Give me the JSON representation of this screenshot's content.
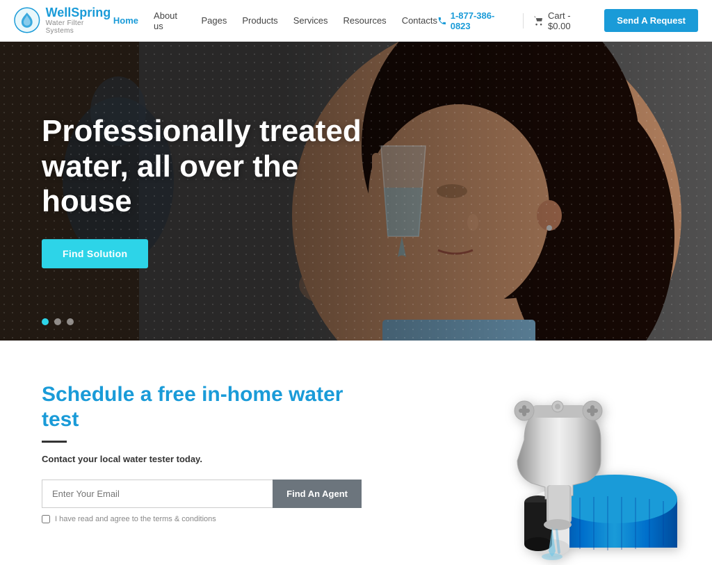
{
  "header": {
    "logo": {
      "brand": "WellSpring",
      "sub": "Water Filter Systems"
    },
    "nav": {
      "items": [
        {
          "label": "Home",
          "active": true
        },
        {
          "label": "About us",
          "active": false
        },
        {
          "label": "Pages",
          "active": false
        },
        {
          "label": "Products",
          "active": false
        },
        {
          "label": "Services",
          "active": false
        },
        {
          "label": "Resources",
          "active": false
        },
        {
          "label": "Contacts",
          "active": false
        }
      ]
    },
    "phone": "1-877-386-0823",
    "cart": "Cart - $0.00",
    "cta": "Send A Request"
  },
  "hero": {
    "title": "Professionally treated water, all over the house",
    "cta": "Find Solution",
    "dots": [
      {
        "active": true
      },
      {
        "active": false
      },
      {
        "active": false
      }
    ]
  },
  "water_test": {
    "title": "Schedule a free in-home water test",
    "subtitle": "Contact your local water tester today.",
    "email_placeholder": "Enter Your Email",
    "agent_btn": "Find An Agent",
    "terms": "I have read and agree to the terms & conditions"
  }
}
